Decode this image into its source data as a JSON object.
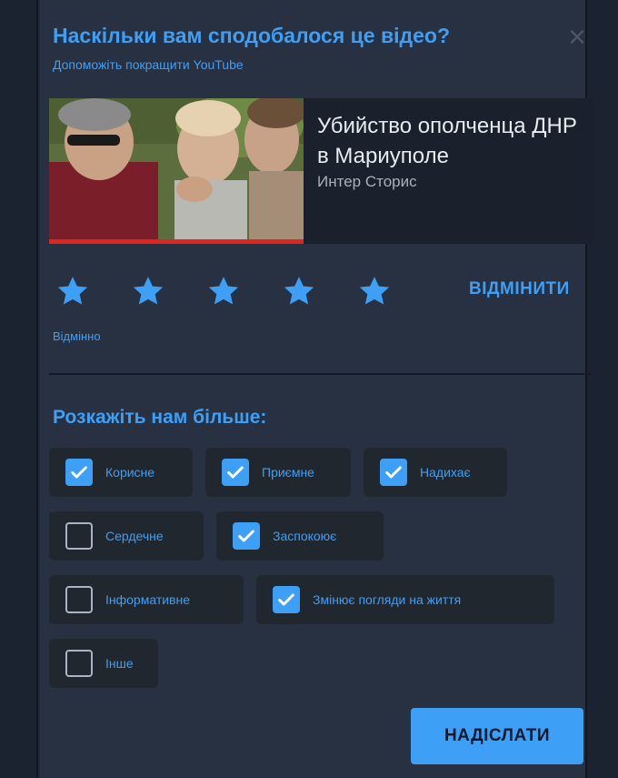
{
  "survey": {
    "title": "Наскільки вам сподобалося це відео?",
    "subtitle": "Допоможіть покращити YouTube",
    "close_icon": "close-icon"
  },
  "video": {
    "title": "Убийство ополченца ДНР в Мариуполе",
    "channel": "Интер Сторис"
  },
  "rating": {
    "stars_total": 5,
    "stars_selected": 5,
    "label": "Відмінно",
    "cancel_label": "ВІДМІНИТИ"
  },
  "feedback": {
    "heading": "Розкажіть нам більше:",
    "options": [
      {
        "label": "Корисне",
        "checked": true
      },
      {
        "label": "Приємне",
        "checked": true
      },
      {
        "label": "Надихає",
        "checked": true
      },
      {
        "label": "Сердечне",
        "checked": false
      },
      {
        "label": "Заспокоює",
        "checked": true
      },
      {
        "label": "Інформативне",
        "checked": false
      },
      {
        "label": "Змінює погляди на життя",
        "checked": true
      },
      {
        "label": "Інше",
        "checked": false
      }
    ]
  },
  "submit_label": "НАДІСЛАТИ",
  "colors": {
    "accent": "#3e9ff6",
    "background": "#283141",
    "progress": "#e2241f"
  }
}
